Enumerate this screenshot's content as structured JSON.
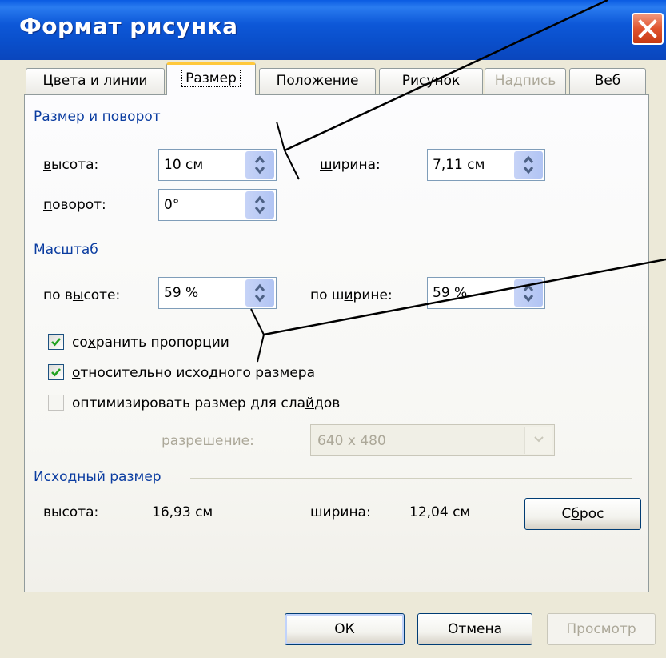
{
  "window": {
    "title": "Формат рисунка"
  },
  "tabs": [
    {
      "label": "Цвета и линии"
    },
    {
      "label": "Размер"
    },
    {
      "label": "Положение"
    },
    {
      "label": "Рисунок"
    },
    {
      "label": "Надпись"
    },
    {
      "label": "Веб"
    }
  ],
  "size_rotate": {
    "title": "Размер и поворот",
    "height_label_key": "в",
    "height_label_rest": "ысота:",
    "height_value": "10 см",
    "width_label_key": "ш",
    "width_label_rest": "ирина:",
    "width_value": "7,11 см",
    "rotation_label_key": "п",
    "rotation_label_rest": "оворот:",
    "rotation_value": "0°"
  },
  "scale": {
    "title": "Масштаб",
    "height_label_pre": "по в",
    "height_label_key": "ы",
    "height_label_rest": "соте:",
    "height_value": "59 %",
    "width_label_pre": "по ш",
    "width_label_key": "и",
    "width_label_rest": "рине:",
    "width_value": "59 %",
    "lock_ratio_pre": "со",
    "lock_ratio_key": "х",
    "lock_ratio_rest": "ранить пропорции",
    "relative_key": "о",
    "relative_rest": "тносительно исходного размера",
    "optimize_pre": "оптимизировать размер для сла",
    "optimize_key": "й",
    "optimize_rest": "дов",
    "resolution_label": "разрешение:",
    "resolution_value": "640 x 480",
    "lock_ratio_checked": true,
    "relative_checked": true,
    "optimize_checked": false
  },
  "original": {
    "title": "Исходный размер",
    "height_label": "высота:",
    "height_value": "16,93 см",
    "width_label": "ширина:",
    "width_value": "12,04 см",
    "reset_pre": "С",
    "reset_key": "б",
    "reset_rest": "рос"
  },
  "buttons": {
    "ok": "ОК",
    "cancel": "Отмена",
    "preview": "Просмотр"
  },
  "colors": {
    "title_bar": "#0a4fcb",
    "group_title": "#0a3ca0",
    "checkmark": "#21a121",
    "close": "#e0532e"
  }
}
